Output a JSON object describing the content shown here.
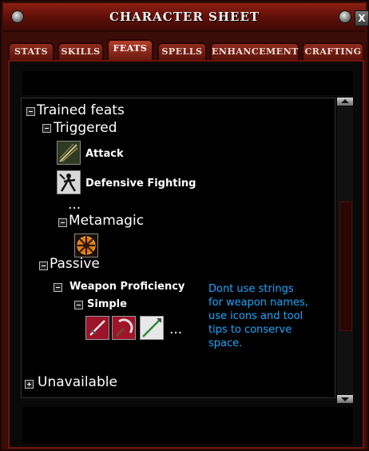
{
  "window": {
    "title": "CHARACTER SHEET",
    "close_label": "X"
  },
  "tabs": [
    {
      "label": "STATS",
      "active": false
    },
    {
      "label": "SKILLS",
      "active": false
    },
    {
      "label": "FEATS",
      "active": true
    },
    {
      "label": "SPELLS",
      "active": false
    },
    {
      "label": "ENHANCEMENT",
      "active": false
    },
    {
      "label": "CRAFTING",
      "active": false
    }
  ],
  "tree": {
    "trained": {
      "label": "Trained feats",
      "expanded": true
    },
    "triggered": {
      "label": "Triggered",
      "expanded": true
    },
    "feats": [
      {
        "label": "Attack",
        "icon": "sword-slash-icon"
      },
      {
        "label": "Defensive Fighting",
        "icon": "defensive-stance-icon"
      }
    ],
    "ellipsis1": "...",
    "metamagic": {
      "label": "Metamagic",
      "expanded": true,
      "icon": "metamagic-sun-icon"
    },
    "passive": {
      "label": "Passive",
      "expanded": true
    },
    "weapon_prof": {
      "label": "Weapon Proficiency",
      "expanded": true
    },
    "simple": {
      "label": "Simple",
      "expanded": true
    },
    "weapon_icons": [
      "dagger-icon",
      "sickle-icon",
      "spear-icon"
    ],
    "ellipsis2": "...",
    "unavailable": {
      "label": "Unavailable",
      "expanded": false
    }
  },
  "annotation": "Dont use strings\nfor weapon names,\nuse icons and tool\ntips to conserve\nspace.",
  "colors": {
    "accent_text": "#1ca8ff",
    "frame": "#6f140b",
    "title_bar": "#8d1e12"
  }
}
